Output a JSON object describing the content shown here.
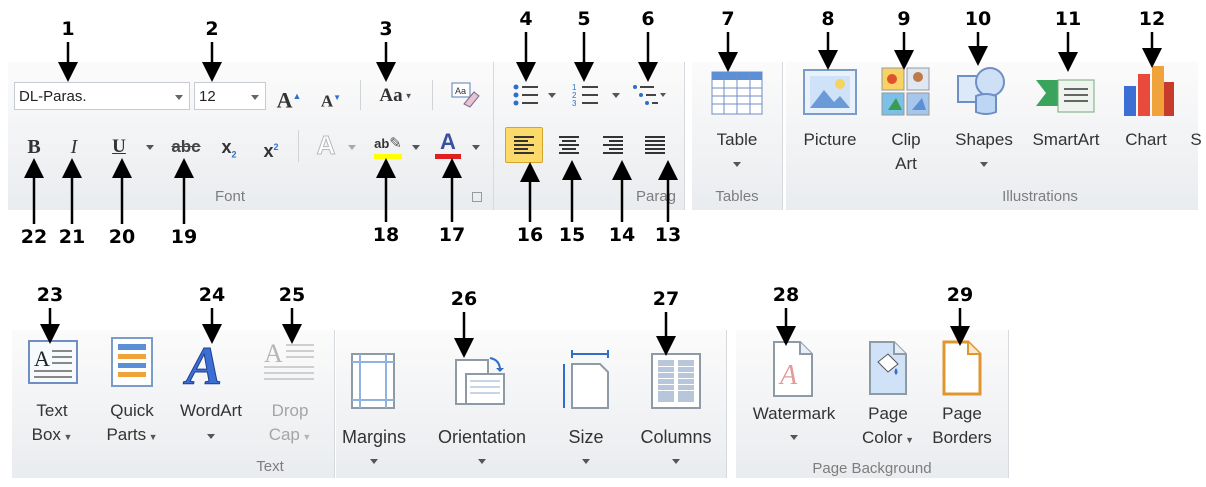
{
  "callouts": [
    "1",
    "2",
    "3",
    "4",
    "5",
    "6",
    "7",
    "8",
    "9",
    "10",
    "11",
    "12",
    "13",
    "14",
    "15",
    "16",
    "17",
    "18",
    "19",
    "20",
    "21",
    "22",
    "23",
    "24",
    "25",
    "26",
    "27",
    "28",
    "29"
  ],
  "home": {
    "font_name": "DL-Paras.",
    "font_size": "12",
    "grow_font": "A",
    "shrink_font": "A",
    "change_case": "Aa",
    "bold": "B",
    "italic": "I",
    "underline": "U",
    "strikethrough": "abc",
    "subscript": "x",
    "subscript_mark": "2",
    "superscript": "x",
    "superscript_mark": "2",
    "text_effects": "A",
    "highlight": "ab",
    "font_color": "A",
    "font_group_label": "Font",
    "para_group_label": "Parag"
  },
  "insert": {
    "table_label": "Table",
    "tables_group_label": "Tables",
    "picture_label": "Picture",
    "clip_art_line1": "Clip",
    "clip_art_line2": "Art",
    "shapes_label": "Shapes",
    "smartart_label": "SmartArt",
    "chart_label": "Chart",
    "cut_off": "S",
    "illustrations_group_label": "Illustrations",
    "text_box_line1": "Text",
    "text_box_line2": "Box",
    "quick_parts_line1": "Quick",
    "quick_parts_line2": "Parts",
    "wordart_label": "WordArt",
    "drop_cap_line1": "Drop",
    "drop_cap_line2": "Cap",
    "text_group_label": "Text"
  },
  "page_layout": {
    "margins_label": "Margins",
    "orientation_label": "Orientation",
    "size_label": "Size",
    "columns_label": "Columns",
    "watermark_label": "Watermark",
    "page_color_line1": "Page",
    "page_color_line2": "Color",
    "page_borders_line1": "Page",
    "page_borders_line2": "Borders",
    "page_background_group_label": "Page Background"
  },
  "colors": {
    "highlight_yellow": "#ffff00",
    "font_red": "#e02020",
    "active_align": "#fcd96b"
  }
}
